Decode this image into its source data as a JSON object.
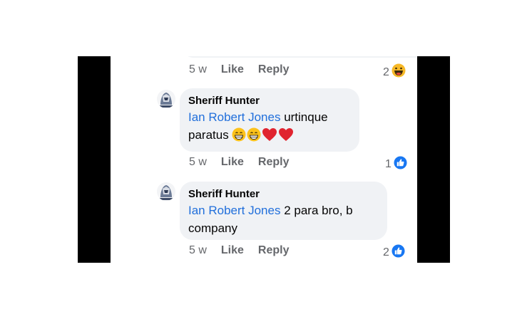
{
  "comments": [
    {
      "actions": {
        "time": "5 w",
        "like": "Like",
        "reply": "Reply"
      },
      "reaction": {
        "count": "2",
        "type": "haha-icon"
      }
    },
    {
      "author": "Sheriff Hunter",
      "mention": "Ian Robert Jones",
      "text_line1": " urtinque",
      "text_line2": "paratus ",
      "emojis": [
        "grinning-face-icon",
        "grinning-face-icon",
        "heart-icon",
        "heart-icon"
      ],
      "actions": {
        "time": "5 w",
        "like": "Like",
        "reply": "Reply"
      },
      "reaction": {
        "count": "1",
        "type": "like-icon"
      }
    },
    {
      "author": "Sheriff Hunter",
      "mention": "Ian Robert Jones",
      "text_line1": " 2 para bro, b",
      "text_line2": "company",
      "actions": {
        "time": "5 w",
        "like": "Like",
        "reply": "Reply"
      },
      "reaction": {
        "count": "2",
        "type": "like-icon"
      }
    }
  ],
  "colors": {
    "bubble": "#f0f2f5",
    "mention": "#216fdb",
    "meta": "#65676b",
    "like_blue": "#1877f2"
  }
}
